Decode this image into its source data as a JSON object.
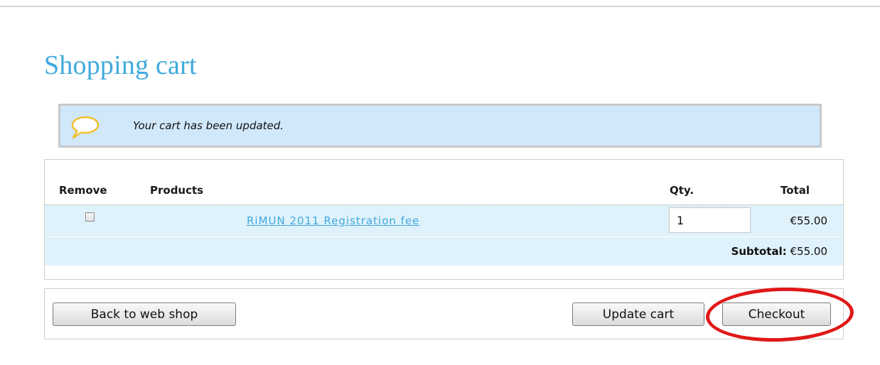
{
  "page": {
    "title": "Shopping cart"
  },
  "status": {
    "message": "Your cart has been updated.",
    "icon": "speech-bubble-icon"
  },
  "cart": {
    "columns": {
      "remove": "Remove",
      "products": "Products",
      "qty": "Qty.",
      "total": "Total"
    },
    "items": [
      {
        "remove_checked": false,
        "product": "RiMUN 2011 Registration fee",
        "qty": "1",
        "total": "€55.00"
      }
    ],
    "subtotal_label": "Subtotal:",
    "subtotal_value": "€55.00"
  },
  "actions": {
    "back_label": "Back to web shop",
    "update_label": "Update cart",
    "checkout_label": "Checkout"
  },
  "colors": {
    "title": "#3fa9dc",
    "status_bg": "#d1e8fb",
    "row_bg": "#dff1fb",
    "link": "#3fa9dc",
    "highlight": "#e01818"
  }
}
